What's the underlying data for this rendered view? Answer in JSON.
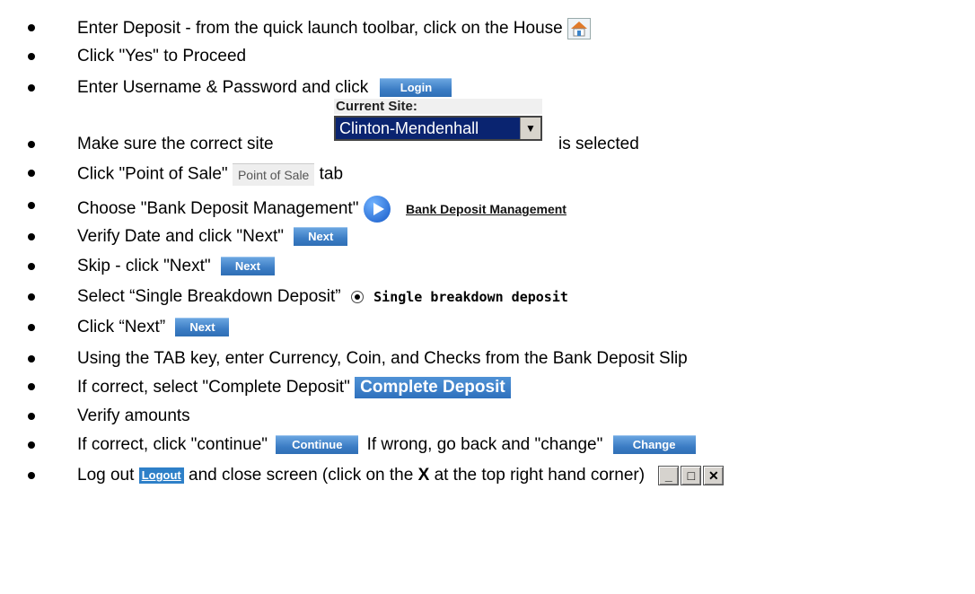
{
  "steps": [
    {
      "text": "Enter Deposit - from the quick launch toolbar, click on the House"
    },
    {
      "text": "Click \"Yes\" to Proceed"
    },
    {
      "text": "Enter Username & Password and click",
      "button": "Login"
    },
    {
      "text_before": "Make sure the correct site",
      "site_label": "Current Site:",
      "site_value": "Clinton-Mendenhall",
      "text_after": "is selected"
    },
    {
      "text_before": "Click  \"Point of Sale\"",
      "tab": "Point of Sale",
      "text_after": "tab"
    },
    {
      "text": "Choose \"Bank Deposit Management\"",
      "link": "Bank Deposit Management"
    },
    {
      "text": "Verify Date and click \"Next\"",
      "button": "Next"
    },
    {
      "text": "Skip - click \"Next\"",
      "button": "Next"
    },
    {
      "text": "Select “Single Breakdown Deposit”",
      "radio_label": "Single breakdown deposit"
    },
    {
      "text": "Click “Next”",
      "button": "Next"
    },
    {
      "text": "Using the TAB key, enter Currency, Coin, and Checks from the Bank Deposit Slip"
    },
    {
      "text": "If correct, select \"Complete Deposit\"",
      "button": "Complete Deposit"
    },
    {
      "text": "Verify amounts"
    },
    {
      "text_before": "If correct, click \"continue\"",
      "button1": "Continue",
      "text_middle": "If wrong, go back and \"change\"",
      "button2": "Change"
    },
    {
      "text_before": "Log out",
      "logout": "Logout",
      "text_middle": "and close screen (click on the",
      "bold": "X",
      "text_after": "at the top right hand corner)"
    }
  ],
  "colors": {
    "button": "#3b7cc4",
    "select_bg": "#0a2470"
  }
}
